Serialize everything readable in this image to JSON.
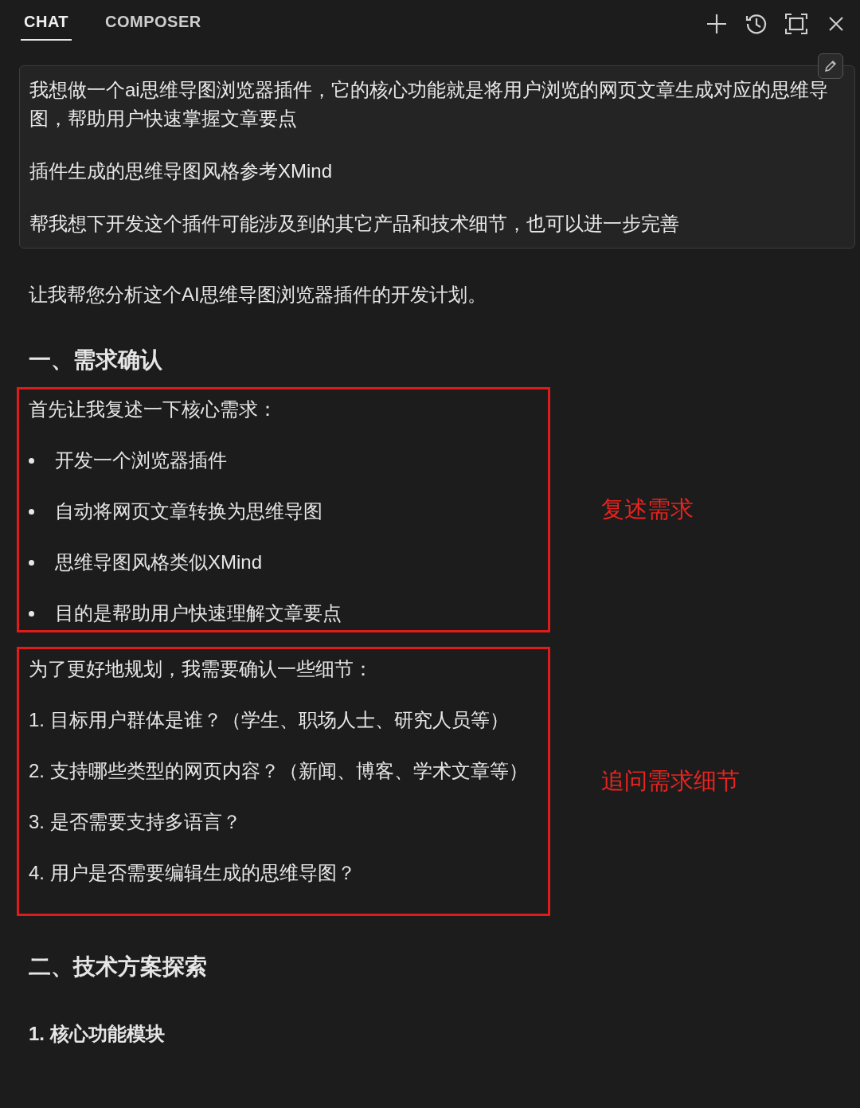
{
  "tabs": [
    {
      "label": "CHAT",
      "selected": true
    },
    {
      "label": "COMPOSER",
      "selected": false
    }
  ],
  "prompt": [
    "我想做一个ai思维导图浏览器插件，它的核心功能就是将用户浏览的网页文章生成对应的思维导图，帮助用户快速掌握文章要点",
    "插件生成的思维导图风格参考XMind",
    "帮我想下开发这个插件可能涉及到的其它产品和技术细节，也可以进一步完善"
  ],
  "reply": [
    {
      "kind": "paragraph",
      "text": "让我帮您分析这个AI思维导图浏览器插件的开发计划。"
    },
    {
      "kind": "heading",
      "text": "一、需求确认"
    },
    {
      "kind": "boxed",
      "annotation": "复述需求",
      "lines": [
        {
          "kind": "text",
          "text": "首先让我复述一下核心需求："
        },
        {
          "kind": "bullet",
          "text": "开发一个浏览器插件"
        },
        {
          "kind": "bullet",
          "text": "自动将网页文章转换为思维导图"
        },
        {
          "kind": "bullet",
          "text": "思维导图风格类似XMind"
        },
        {
          "kind": "bullet",
          "text": "目的是帮助用户快速理解文章要点"
        }
      ]
    },
    {
      "kind": "boxed",
      "annotation": "追问需求细节",
      "lines": [
        {
          "kind": "text",
          "text": "为了更好地规划，我需要确认一些细节："
        },
        {
          "kind": "text",
          "text": "1. 目标用户群体是谁？（学生、职场人士、研究人员等）"
        },
        {
          "kind": "text",
          "text": "2. 支持哪些类型的网页内容？（新闻、博客、学术文章等）"
        },
        {
          "kind": "text",
          "text": "3. 是否需要支持多语言？"
        },
        {
          "kind": "text",
          "text": "4. 用户是否需要编辑生成的思维导图？"
        }
      ]
    },
    {
      "kind": "heading",
      "text": "二、技术方案探索"
    },
    {
      "kind": "subheading",
      "text": "1. 核心功能模块"
    }
  ]
}
